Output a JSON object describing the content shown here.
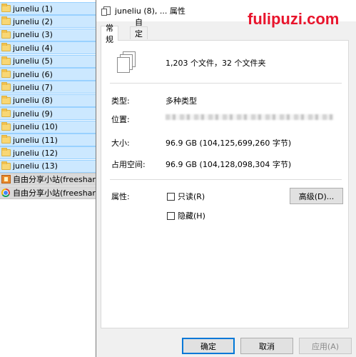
{
  "explorer": {
    "items": [
      {
        "name": "juneliu (1)",
        "type": "folder"
      },
      {
        "name": "juneliu (2)",
        "type": "folder"
      },
      {
        "name": "juneliu (3)",
        "type": "folder"
      },
      {
        "name": "juneliu (4)",
        "type": "folder"
      },
      {
        "name": "juneliu (5)",
        "type": "folder"
      },
      {
        "name": "juneliu (6)",
        "type": "folder"
      },
      {
        "name": "juneliu (7)",
        "type": "folder"
      },
      {
        "name": "juneliu (8)",
        "type": "folder"
      },
      {
        "name": "juneliu (9)",
        "type": "folder"
      },
      {
        "name": "juneliu (10)",
        "type": "folder"
      },
      {
        "name": "juneliu (11)",
        "type": "folder"
      },
      {
        "name": "juneliu (12)",
        "type": "folder"
      },
      {
        "name": "juneliu (13)",
        "type": "folder"
      },
      {
        "name": "自由分享小站(freeshare",
        "type": "package"
      },
      {
        "name": "自由分享小站(freeshare",
        "type": "chrome"
      }
    ]
  },
  "dialog": {
    "title": "juneliu (8), ... 属性",
    "watermark": "fulipuzi.com",
    "tabs": [
      {
        "label": "常规",
        "active": true
      },
      {
        "label": "自定义",
        "active": false
      }
    ],
    "summary": "1,203 个文件，32 个文件夹",
    "fields": {
      "type_label": "类型:",
      "type_value": "多种类型",
      "location_label": "位置:",
      "size_label": "大小:",
      "size_value": "96.9 GB (104,125,699,260 字节)",
      "disk_label": "占用空间:",
      "disk_value": "96.9 GB (104,128,098,304 字节)",
      "attr_label": "属性:"
    },
    "attributes": {
      "readonly_label": "只读(R)",
      "hidden_label": "隐藏(H)",
      "advanced_button": "高级(D)..."
    },
    "buttons": {
      "ok": "确定",
      "cancel": "取消",
      "apply": "应用(A)"
    }
  }
}
